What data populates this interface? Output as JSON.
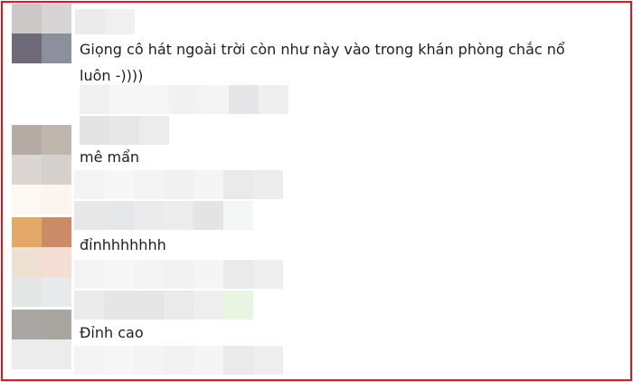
{
  "comments": [
    {
      "line1": "Giọng cô hát ngoài trời còn như này vào trong khán phòng chắc nổ",
      "line2": "luôn -))))"
    },
    {
      "line1": "mê mẩn"
    },
    {
      "line1": "đỉnhhhhhhh"
    },
    {
      "line1": "Đỉnh cao"
    }
  ],
  "colors": {
    "frame_border": "#e8121c",
    "text": "#1c1e21"
  }
}
